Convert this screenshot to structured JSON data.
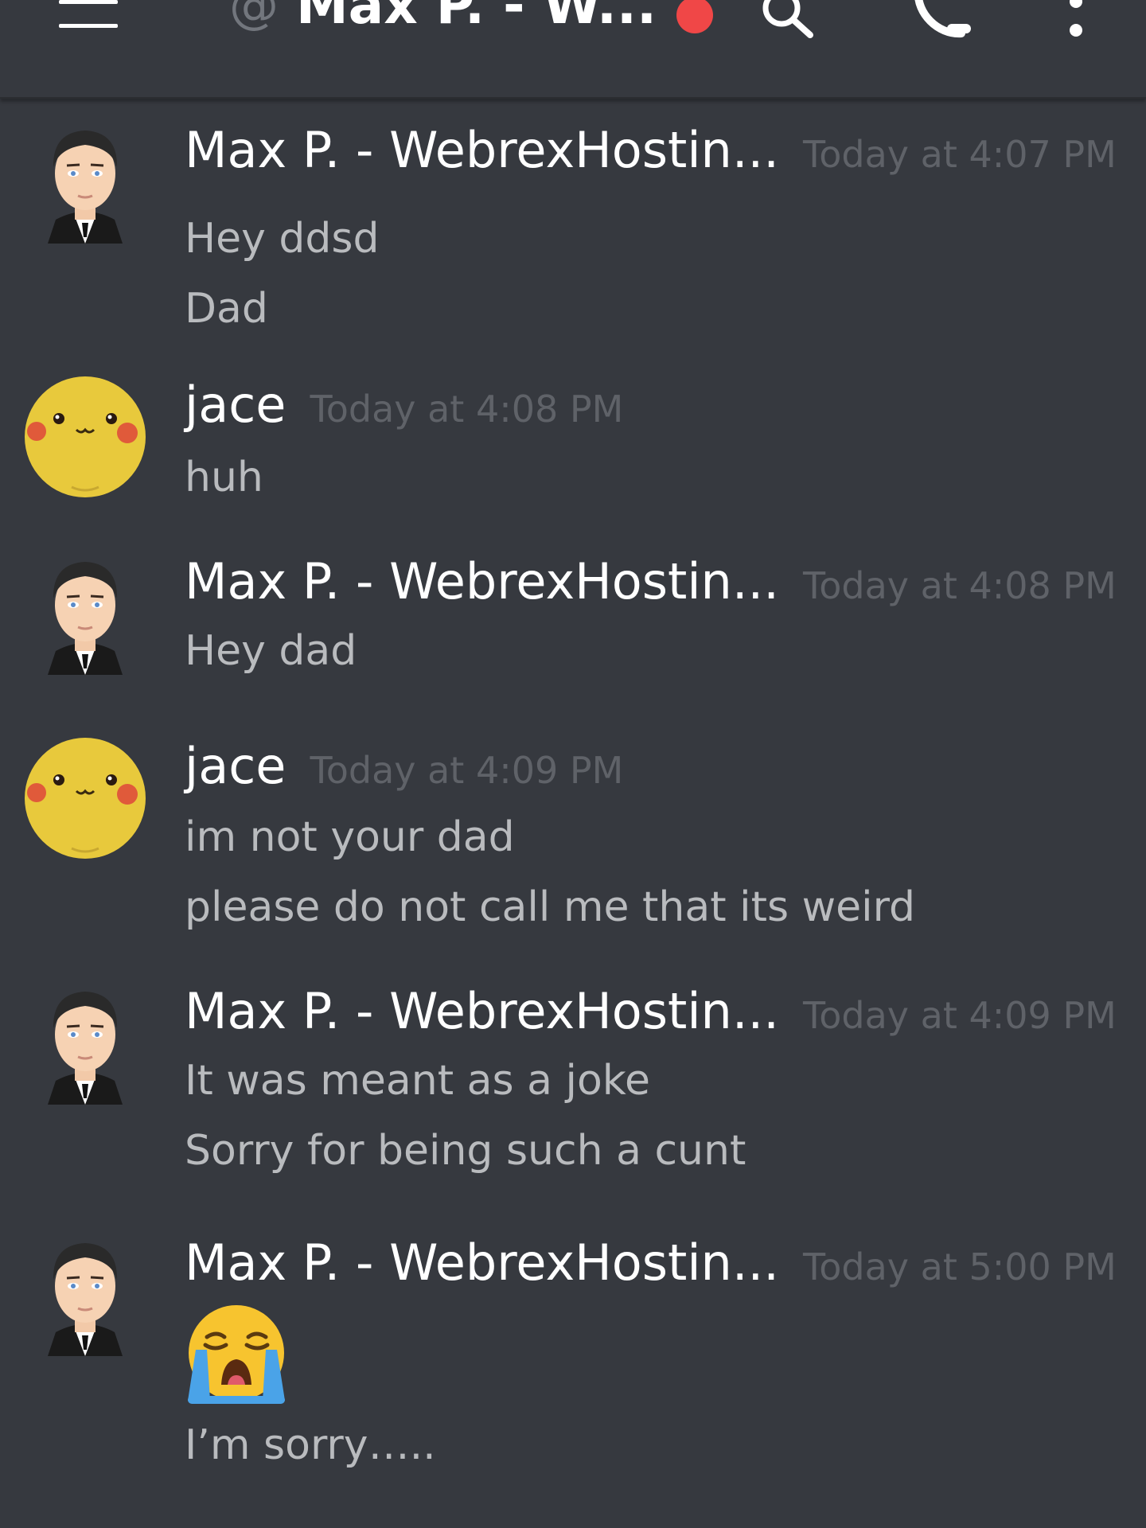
{
  "header": {
    "at_symbol": "@",
    "channel_name": "Max P. - W...",
    "icons": [
      "menu-icon",
      "status-dot",
      "search-icon",
      "phone-icon",
      "more-icon"
    ],
    "status_color": "#f04747"
  },
  "colors": {
    "background": "#36393f",
    "author": "#ffffff",
    "timestamp": "#5f6268",
    "message_text": "#b9bbbe"
  },
  "messages": [
    {
      "author": "Max P. - WebrexHostin...",
      "timestamp": "Today at 4:07 PM",
      "avatar": "businessman-avatar",
      "lines": [
        "Hey ddsd",
        "Dad"
      ]
    },
    {
      "author": "jace",
      "timestamp": "Today at 4:08 PM",
      "avatar": "pikachu-avatar",
      "lines": [
        "huh"
      ]
    },
    {
      "author": "Max P. - WebrexHostin...",
      "timestamp": "Today at 4:08 PM",
      "avatar": "businessman-avatar",
      "lines": [
        "Hey dad"
      ]
    },
    {
      "author": "jace",
      "timestamp": "Today at 4:09 PM",
      "avatar": "pikachu-avatar",
      "lines": [
        "im not your dad",
        "please do not call me that its weird"
      ]
    },
    {
      "author": "Max P. - WebrexHostin...",
      "timestamp": "Today at 4:09 PM",
      "avatar": "businessman-avatar",
      "lines": [
        "It was meant as a joke",
        "Sorry for being such a cunt"
      ]
    },
    {
      "author": "Max P. - WebrexHostin...",
      "timestamp": "Today at 5:00 PM",
      "avatar": "businessman-avatar",
      "emoji": "loudly-crying-face-emoji",
      "lines": [
        "I’m sorry….."
      ]
    }
  ]
}
